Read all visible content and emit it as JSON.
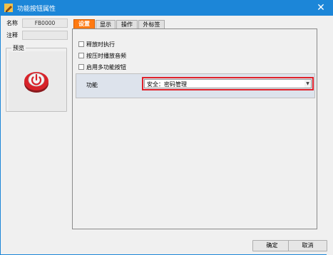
{
  "window": {
    "title": "功能按钮属性",
    "close_glyph": "✕"
  },
  "props": {
    "name_label": "名称",
    "name_value": "FB0000",
    "note_label": "注释",
    "note_value": "",
    "preview_label": "预览"
  },
  "tabs": [
    {
      "label": "设置",
      "active": true
    },
    {
      "label": "显示",
      "active": false
    },
    {
      "label": "操作",
      "active": false
    },
    {
      "label": "外标签",
      "active": false
    }
  ],
  "settings": {
    "checkboxes": [
      {
        "label": "释放时执行",
        "checked": false
      },
      {
        "label": "按压时播放音频",
        "checked": false
      },
      {
        "label": "启用多功能按钮",
        "checked": false
      }
    ],
    "function_label": "功能",
    "function_value": "安全：密码管理",
    "function_arrow": "▼"
  },
  "buttons": {
    "ok_label": "确定",
    "cancel_label": "取消"
  },
  "colors": {
    "titlebar": "#1c86d8",
    "active_tab": "#ff7a12",
    "highlight_border": "#e0222a",
    "power_button_red": "#d8232a"
  },
  "icons": {
    "app": "pencil-app-icon",
    "preview": "power-button-icon"
  }
}
